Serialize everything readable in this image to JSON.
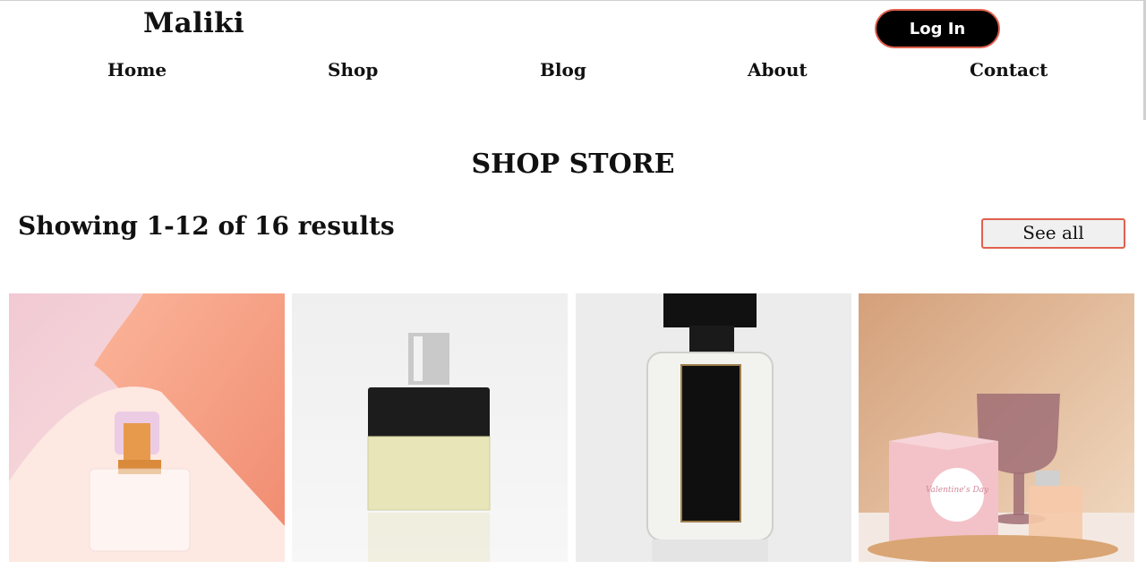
{
  "header": {
    "logo": "Maliki",
    "login_label": "Log In"
  },
  "nav": {
    "items": [
      "Home",
      "Shop",
      "Blog",
      "About",
      "Contact"
    ]
  },
  "main": {
    "title": "SHOP STORE",
    "results_text": "Showing 1-12 of 16 results",
    "see_all_label": "See all"
  },
  "products": [
    {
      "image": "pink-perfume-bottle-image"
    },
    {
      "image": "green-perfume-black-cap-image"
    },
    {
      "image": "black-label-perfume-image"
    },
    {
      "image": "valentines-gift-perfume-image",
      "box_text": "Valentine's Day"
    }
  ],
  "colors": {
    "accent_border": "#e0604e",
    "button_bg": "#000000",
    "see_all_bg": "#f0f0f0"
  }
}
